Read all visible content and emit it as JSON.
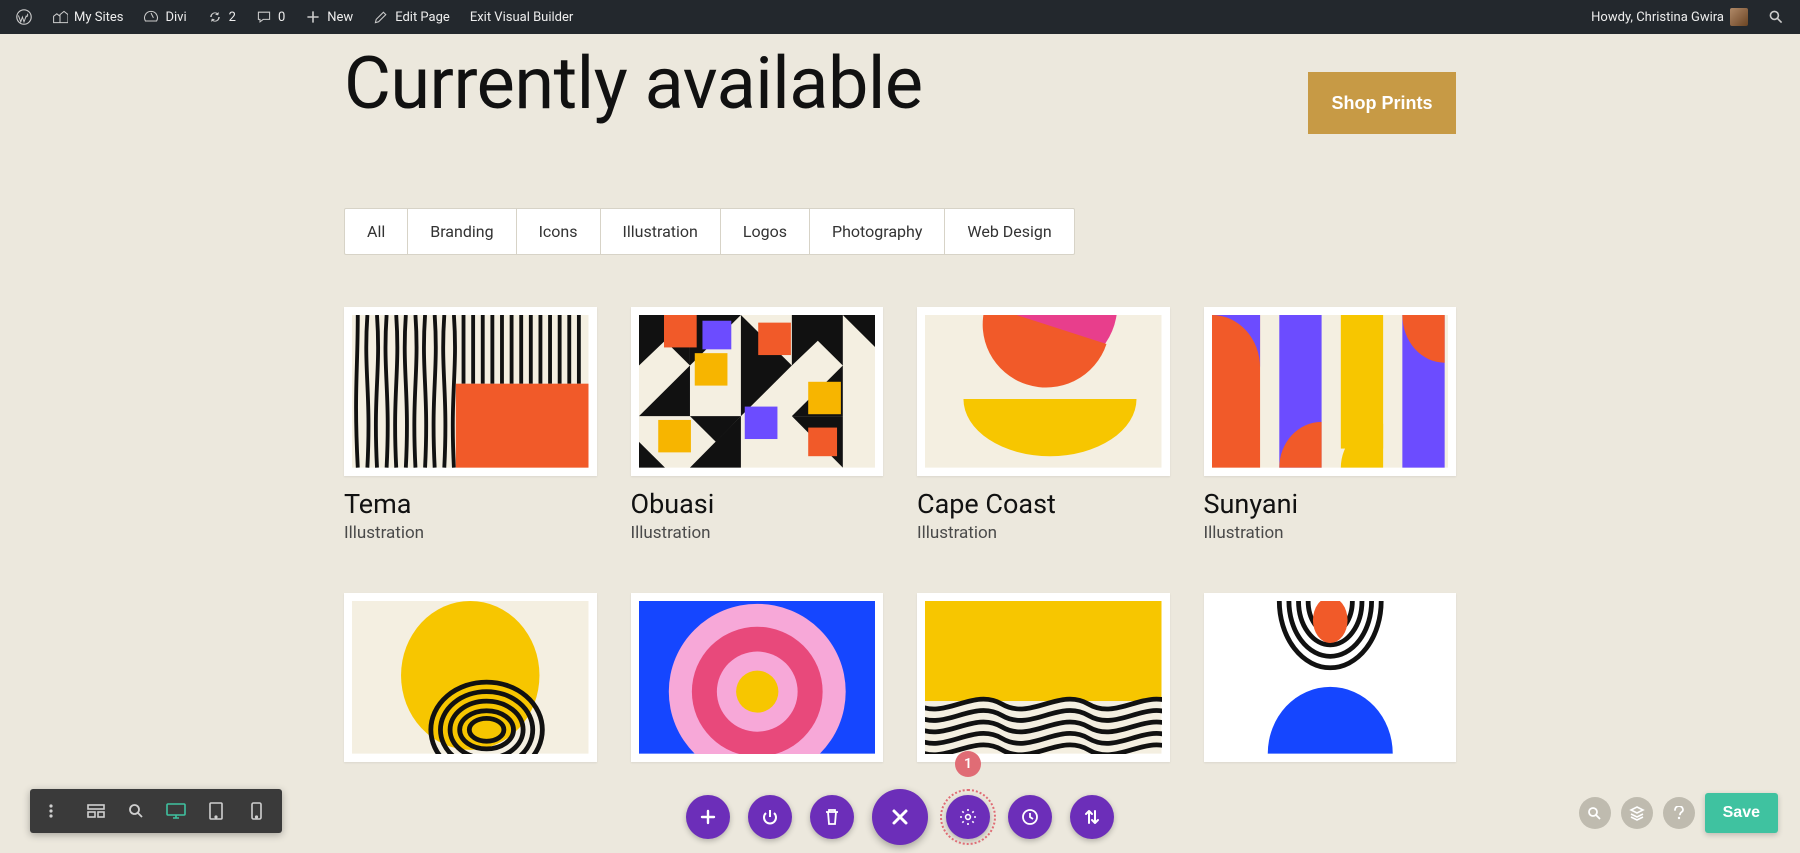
{
  "adminbar": {
    "my_sites": "My Sites",
    "divi": "Divi",
    "updates_count": "2",
    "comments_count": "0",
    "new": "New",
    "edit_page": "Edit Page",
    "exit_vb": "Exit Visual Builder",
    "howdy": "Howdy, Christina Gwira"
  },
  "page": {
    "title": "Currently available",
    "shop_btn": "Shop Prints"
  },
  "tabs": [
    "All",
    "Branding",
    "Icons",
    "Illustration",
    "Logos",
    "Photography",
    "Web Design"
  ],
  "cards": [
    {
      "title": "Tema",
      "cat": "Illustration"
    },
    {
      "title": "Obuasi",
      "cat": "Illustration"
    },
    {
      "title": "Cape Coast",
      "cat": "Illustration"
    },
    {
      "title": "Sunyani",
      "cat": "Illustration"
    },
    {
      "title": "",
      "cat": ""
    },
    {
      "title": "",
      "cat": ""
    },
    {
      "title": "",
      "cat": ""
    },
    {
      "title": "",
      "cat": ""
    }
  ],
  "builder": {
    "badge": "1",
    "save": "Save"
  }
}
